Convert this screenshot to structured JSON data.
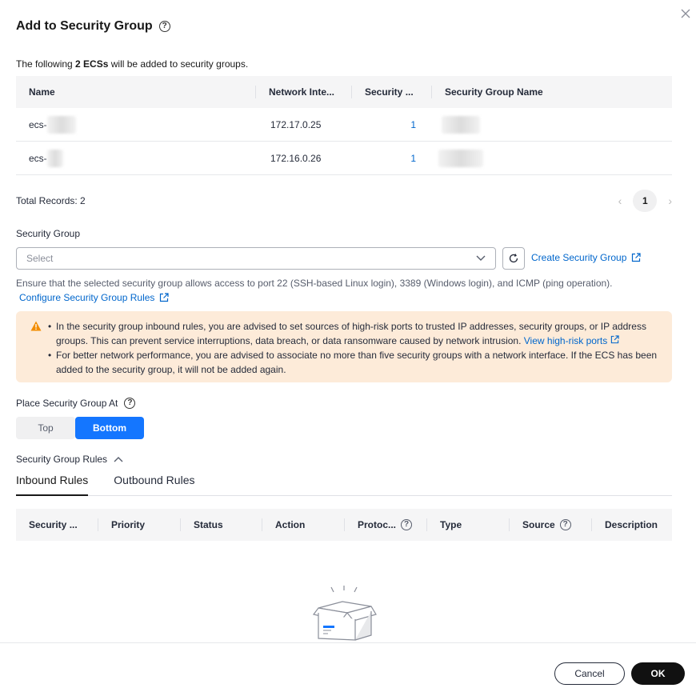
{
  "dialog": {
    "title": "Add to Security Group",
    "intro_prefix": "The following ",
    "intro_count": "2 ECSs",
    "intro_suffix": " will be added to security groups."
  },
  "ecs_table": {
    "columns": [
      "Name",
      "Network Inte...",
      "Security ...",
      "Security Group Name"
    ],
    "rows": [
      {
        "name": "ecs-",
        "network": "172.17.0.25",
        "count": "1"
      },
      {
        "name": "ecs-",
        "network": "172.16.0.26",
        "count": "1"
      }
    ]
  },
  "pagination": {
    "total": "Total Records: 2",
    "page": "1"
  },
  "security_group": {
    "label": "Security Group",
    "placeholder": "Select",
    "create_link": "Create Security Group",
    "hint": "Ensure that the selected security group allows access to port 22 (SSH-based Linux login), 3389 (Windows login), and ICMP (ping operation).",
    "configure_link": "Configure Security Group Rules"
  },
  "warning": {
    "item1": "In the security group inbound rules, you are advised to set sources of high-risk ports to trusted IP addresses, security groups, or IP address groups. This can prevent service interruptions, data breach, or data ransomware caused by network intrusion.",
    "item1_link": "View high-risk ports",
    "item2": "For better network performance, you are advised to associate no more than five security groups with a network interface. If the ECS has been added to the security group, it will not be added again."
  },
  "placement": {
    "label": "Place Security Group At",
    "top": "Top",
    "bottom": "Bottom",
    "selected": "Bottom"
  },
  "rules": {
    "label": "Security Group Rules",
    "tabs": [
      "Inbound Rules",
      "Outbound Rules"
    ],
    "active_tab": "Inbound Rules",
    "columns": [
      "Security ...",
      "Priority",
      "Status",
      "Action",
      "Protoc...",
      "Type",
      "Source",
      "Description"
    ]
  },
  "footer": {
    "cancel": "Cancel",
    "ok": "OK"
  },
  "colors": {
    "accent": "#1476ff",
    "link": "#0066cc",
    "warning_bg": "#fdebd9",
    "warning_icon": "#f28c00"
  }
}
